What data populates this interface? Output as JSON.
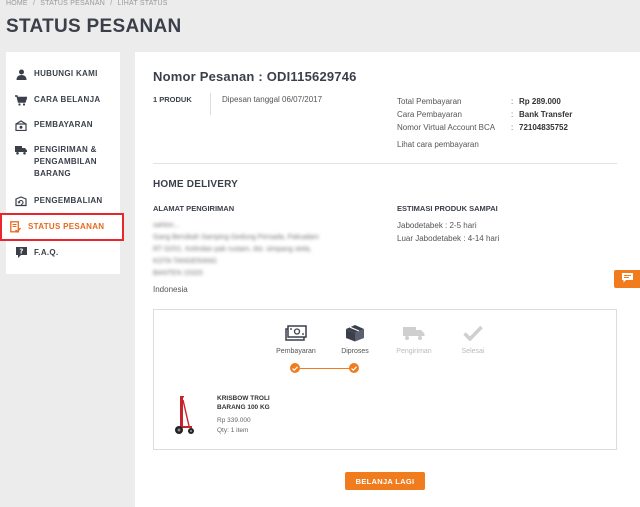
{
  "breadcrumb": [
    "HOME",
    "/",
    "STATUS PESANAN",
    "/",
    "LIHAT STATUS"
  ],
  "page_title": "STATUS PESANAN",
  "sidebar": {
    "items": [
      {
        "label": "HUBUNGI KAMI",
        "icon": "contact-person-icon"
      },
      {
        "label": "CARA BELANJA",
        "icon": "shopping-cart-icon"
      },
      {
        "label": "PEMBAYARAN",
        "icon": "payment-icon"
      },
      {
        "label": "PENGIRIMAN & PENGAMBILAN BARANG",
        "icon": "delivery-truck-icon"
      },
      {
        "label": "PENGEMBALIAN",
        "icon": "return-box-icon"
      },
      {
        "label": "STATUS PESANAN",
        "icon": "order-status-icon",
        "active": true
      },
      {
        "label": "F.A.Q.",
        "icon": "faq-icon"
      }
    ]
  },
  "order": {
    "title": "Nomor Pesanan : ODI115629746",
    "product_count": "1 PRODUK",
    "ordered_on": "Dipesan tanggal 06/07/2017",
    "payment": {
      "total_label": "Total Pembayaran",
      "total_value": "Rp 289.000",
      "method_label": "Cara Pembayaran",
      "method_value": "Bank Transfer",
      "va_label": "Nomor Virtual Account BCA",
      "va_value": "72104835752",
      "colon": ":",
      "how_to_pay": "Lihat cara pembayaran"
    }
  },
  "delivery": {
    "title": "HOME DELIVERY",
    "address_heading": "ALAMAT PENGIRIMAN",
    "address_lines": [
      "sahlon...",
      "Gang Bersikah Samping Gedung Persada, Pakualam",
      "RT 02/01. Kelindan pak rustam, dst. simpang stela,",
      "KOTA TANGERANG",
      "BANTEN 15320"
    ],
    "country": "Indonesia",
    "estimate_heading": "ESTIMASI PRODUK SAMPAI",
    "estimates": [
      "Jabodetabek : 2-5 hari",
      "Luar Jabodetabek : 4-14 hari"
    ]
  },
  "tracking": {
    "steps": [
      {
        "label": "Pembayaran",
        "icon": "money-icon",
        "done": true
      },
      {
        "label": "Diproses",
        "icon": "package-box-icon",
        "done": true
      },
      {
        "label": "Pengiriman",
        "icon": "shipping-truck-icon",
        "done": false
      },
      {
        "label": "Selesai",
        "icon": "checkmark-icon",
        "done": false
      }
    ],
    "product": {
      "name": "KRISBOW TROLI BARANG 100 KG",
      "price": "Rp 339.000",
      "qty": "Qty: 1 item",
      "image": "hand-trolley-image"
    }
  },
  "actions": {
    "continue_shopping": "BELANJA LAGI"
  },
  "colors": {
    "accent": "#f07c1e",
    "active_border": "#e8262c",
    "title_text": "#3a3f4a",
    "background": "#ececec"
  }
}
